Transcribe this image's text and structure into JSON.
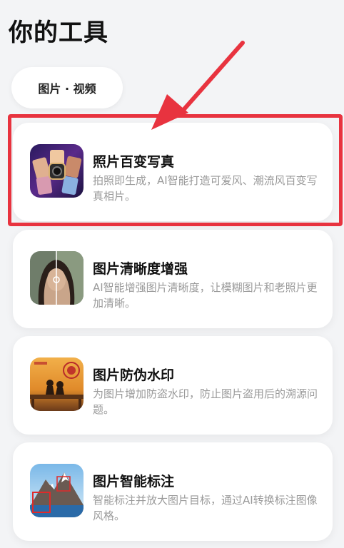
{
  "page": {
    "title": "你的工具"
  },
  "tabs": [
    {
      "label": "图片 · 视频"
    }
  ],
  "tools": [
    {
      "title": "照片百变写真",
      "description": "拍照即生成，AI智能打造可爱风、潮流风百变写真相片。",
      "icon": "photo-portrait-thumbnail"
    },
    {
      "title": "图片清晰度增强",
      "description": "AI智能增强图片清晰度，让模糊图片和老照片更加清晰。",
      "icon": "image-enhance-thumbnail"
    },
    {
      "title": "图片防伪水印",
      "description": "为图片增加防盗水印，防止图片盗用后的溯源问题。",
      "icon": "watermark-thumbnail"
    },
    {
      "title": "图片智能标注",
      "description": "智能标注并放大图片目标，通过AI转换标注图像风格。",
      "icon": "smart-annotation-thumbnail"
    }
  ],
  "colors": {
    "highlight": "#e8333f",
    "card_bg": "#ffffff",
    "page_bg": "#f3f4f6"
  }
}
